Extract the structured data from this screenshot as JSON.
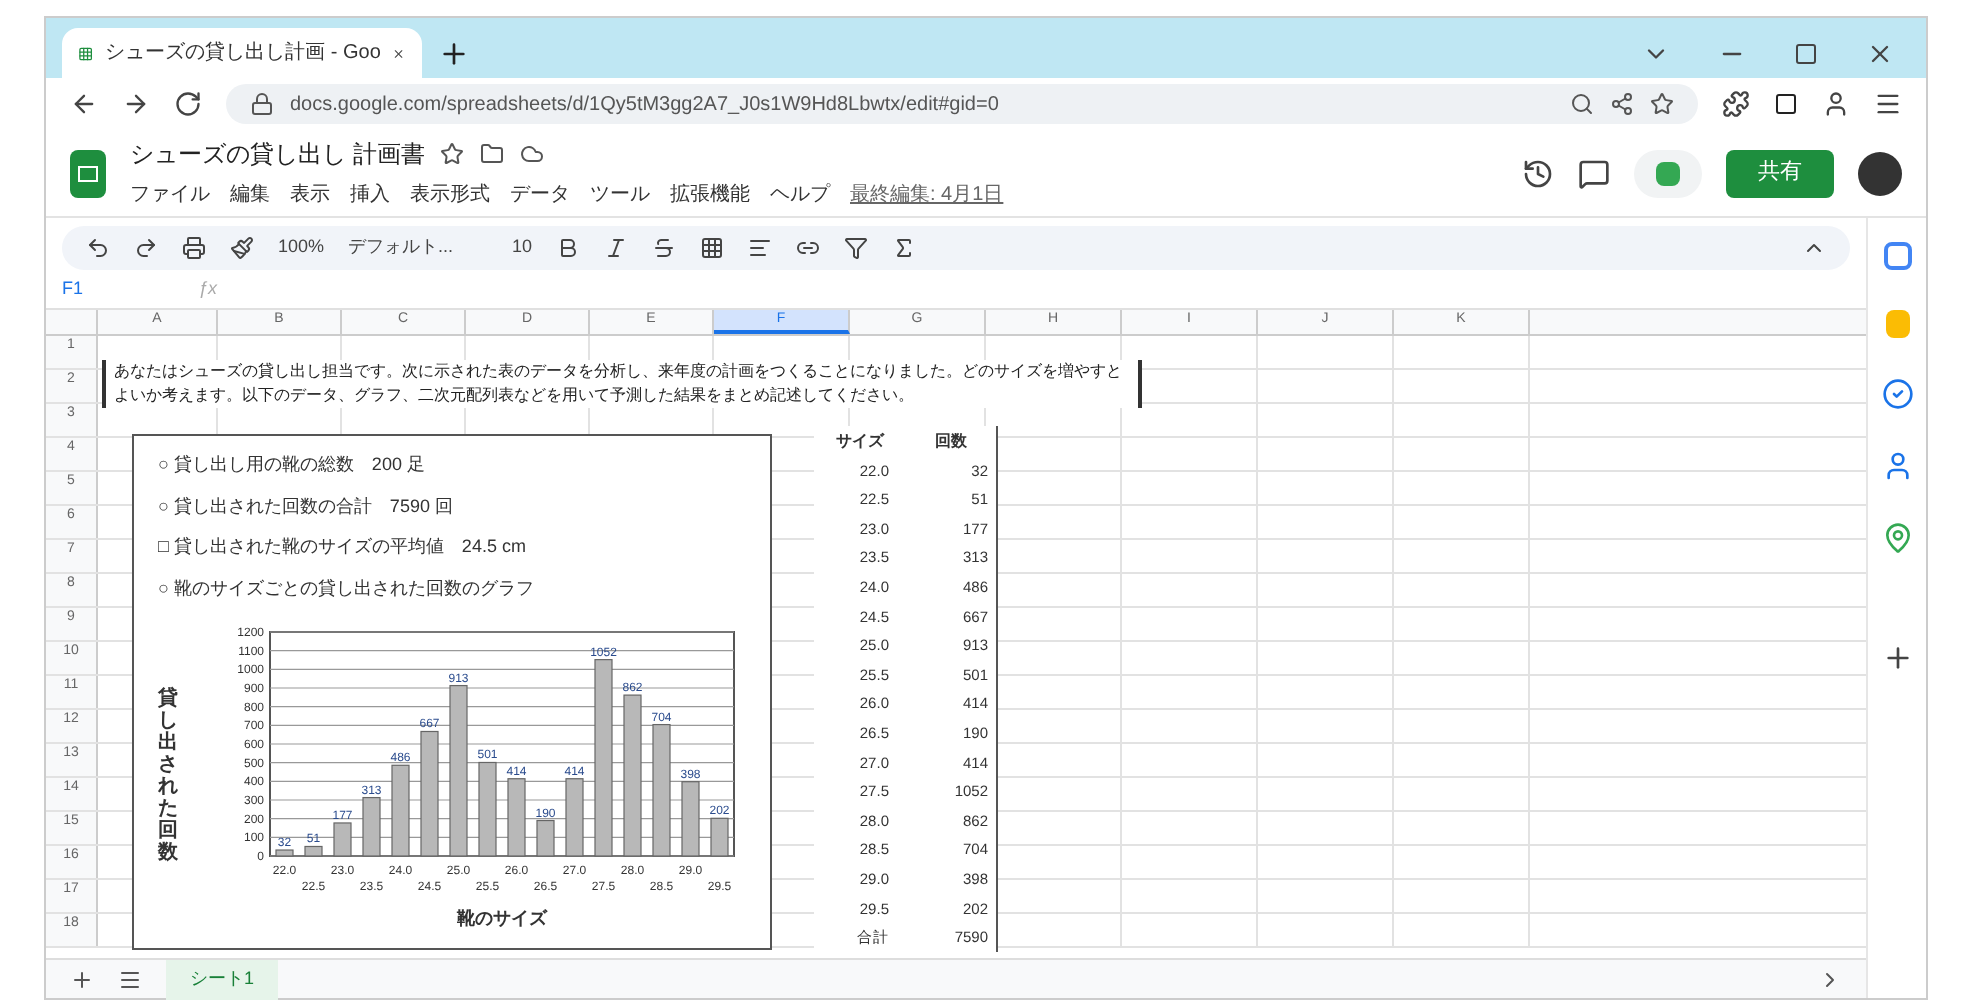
{
  "browser": {
    "tab_title": "シューズの貸し出し計画 - Goo",
    "url": "docs.google.com/spreadsheets/d/1Qy5tM3gg2A7_J0s1W9Hd8Lbwtx/edit#gid=0"
  },
  "doc": {
    "title": "シューズの貸し出し 計画書",
    "menus": [
      "ファイル",
      "編集",
      "表示",
      "挿入",
      "表示形式",
      "データ",
      "ツール",
      "拡張機能",
      "ヘルプ"
    ],
    "last_edit": "最終編集: 4月1日",
    "share": "共有"
  },
  "toolbar": {
    "zoom": "100%",
    "font": "デフォルト...",
    "font_size": "10"
  },
  "formula_bar": {
    "name_box": "F1",
    "fx": "ƒx"
  },
  "columns": [
    {
      "label": "A",
      "selected": false
    },
    {
      "label": "B",
      "selected": false
    },
    {
      "label": "C",
      "selected": false
    },
    {
      "label": "D",
      "selected": false
    },
    {
      "label": "E",
      "selected": false
    },
    {
      "label": "F",
      "selected": true
    },
    {
      "label": "G",
      "selected": false
    },
    {
      "label": "H",
      "selected": false
    },
    {
      "label": "I",
      "selected": false
    },
    {
      "label": "J",
      "selected": false
    },
    {
      "label": "K",
      "selected": false
    }
  ],
  "row_numbers": [
    "1",
    "2",
    "3",
    "4",
    "5",
    "6",
    "7",
    "8",
    "9",
    "10",
    "11",
    "12",
    "13",
    "14",
    "15",
    "16",
    "17",
    "18"
  ],
  "instruction": "あなたはシューズの貸し出し担当です。次に示された表のデータを分析し、来年度の計画をつくることになりました。どのサイズを増やすとよいか考えます。以下のデータ、グラフ、二次元配列表などを用いて予測した結果をまとめ記述してください。",
  "card": {
    "items": [
      "○ 貸し出し用の靴の総数　200 足",
      "○ 貸し出された回数の合計　7590 回",
      "□ 貸し出された靴のサイズの平均値　24.5 cm",
      "○ 靴のサイズごとの貸し出された回数のグラフ"
    ],
    "chart_data": {
      "type": "bar",
      "xlabel": "靴のサイズ",
      "ylabel": "貸し出された回数",
      "categories": [
        "22.0",
        "22.5",
        "23.0",
        "23.5",
        "24.0",
        "24.5",
        "25.0",
        "25.5",
        "26.0",
        "26.5",
        "27.0",
        "27.5",
        "28.0",
        "28.5",
        "29.0",
        "29.5"
      ],
      "grid": true,
      "series": [
        {
          "color": "#b8b8b8",
          "values": [
            32,
            51,
            177,
            313,
            486,
            667,
            913,
            501,
            414,
            190,
            414,
            1052,
            862,
            704,
            398,
            202
          ]
        }
      ],
      "ylim": [
        0,
        1200
      ],
      "yticks": [
        0,
        100,
        200,
        300,
        400,
        500,
        600,
        700,
        800,
        900,
        1000,
        1100,
        1200
      ],
      "data_labels": true
    }
  },
  "size_table": {
    "headers": [
      "サイズ",
      "回数"
    ],
    "rows": [
      [
        "22.0",
        "32"
      ],
      [
        "22.5",
        "51"
      ],
      [
        "23.0",
        "177"
      ],
      [
        "23.5",
        "313"
      ],
      [
        "24.0",
        "486"
      ],
      [
        "24.5",
        "667"
      ],
      [
        "25.0",
        "913"
      ],
      [
        "25.5",
        "501"
      ],
      [
        "26.0",
        "414"
      ],
      [
        "26.5",
        "190"
      ],
      [
        "27.0",
        "414"
      ],
      [
        "27.5",
        "1052"
      ],
      [
        "28.0",
        "862"
      ],
      [
        "28.5",
        "704"
      ],
      [
        "29.0",
        "398"
      ],
      [
        "29.5",
        "202"
      ]
    ],
    "total": [
      "合計",
      "7590"
    ]
  },
  "sheet_tabs": [
    {
      "label": "シート1",
      "selected": true
    }
  ]
}
